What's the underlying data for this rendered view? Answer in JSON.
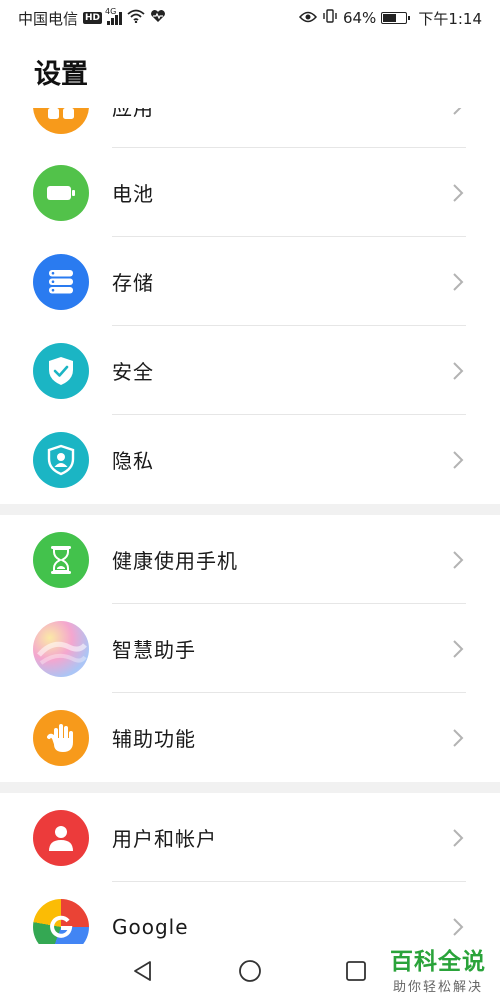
{
  "status_bar": {
    "carrier": "中国电信",
    "hd_badge": "HD",
    "network_type": "4G",
    "battery_percent": "64%",
    "battery_level": 0.64,
    "time": "下午1:14",
    "icons": [
      "signal-icon",
      "wifi-icon",
      "heartbeat-icon",
      "eye-icon",
      "vibrate-icon",
      "battery-icon"
    ]
  },
  "header": {
    "title": "设置"
  },
  "settings_groups": [
    {
      "items": [
        {
          "label": "应用",
          "icon": "apps-icon",
          "color": "#F79A1B"
        },
        {
          "label": "电池",
          "icon": "battery-icon",
          "color": "#52C24A"
        },
        {
          "label": "存储",
          "icon": "storage-icon",
          "color": "#2A7BF0"
        },
        {
          "label": "安全",
          "icon": "shield-check-icon",
          "color": "#1BB5C4"
        },
        {
          "label": "隐私",
          "icon": "privacy-shield-icon",
          "color": "#1BB5C4"
        }
      ]
    },
    {
      "items": [
        {
          "label": "健康使用手机",
          "icon": "hourglass-icon",
          "color": "#43C24C"
        },
        {
          "label": "智慧助手",
          "icon": "assistant-icon",
          "color": "#E9A3D0"
        },
        {
          "label": "辅助功能",
          "icon": "hand-icon",
          "color": "#F79A1B"
        }
      ]
    },
    {
      "items": [
        {
          "label": "用户和帐户",
          "icon": "user-icon",
          "color": "#EC3B3B"
        },
        {
          "label": "Google",
          "icon": "google-icon",
          "color": "#EA4335"
        }
      ]
    }
  ],
  "nav_bar": {
    "back": "back-triangle-icon",
    "home": "home-circle-icon",
    "recents": "recents-square-icon"
  },
  "watermark": {
    "title": "百科全说",
    "subtitle": "助你轻松解决"
  }
}
